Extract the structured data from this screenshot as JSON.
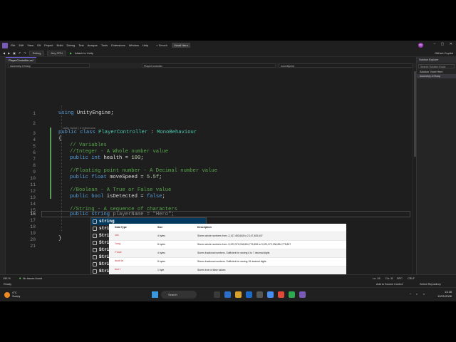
{
  "menubar": {
    "items": [
      "File",
      "Edit",
      "View",
      "Git",
      "Project",
      "Build",
      "Debug",
      "Test",
      "Analyze",
      "Tools",
      "Extensions",
      "Window",
      "Help"
    ],
    "search": "Search",
    "solution": "Voxel Hero",
    "avatar": "KR",
    "window_controls": "– ▢ ✕"
  },
  "toolbar": {
    "config": "Debug",
    "platform": "Any CPU",
    "attach": "Attach to Unity",
    "copilot": "GitHub Copilot"
  },
  "tab": {
    "title": "PlayerController.cs*"
  },
  "navbar": {
    "project": "Assembly-CSharp",
    "class": "PlayerController",
    "member": "moveSpeed"
  },
  "editor": {
    "lines": [
      {
        "n": "1",
        "text": "using UnityEngine;"
      },
      {
        "n": "2",
        "text": ""
      },
      {
        "n": "3",
        "text": "public class PlayerController : MonoBehaviour"
      },
      {
        "n": "4",
        "text": "{"
      },
      {
        "n": "5",
        "text": "// Variables"
      },
      {
        "n": "6",
        "text": "//Integer - A Whole number value"
      },
      {
        "n": "7",
        "text": "public int health = 100;"
      },
      {
        "n": "8",
        "text": ""
      },
      {
        "n": "9",
        "text": "//Floating point number - A Decimal number value"
      },
      {
        "n": "10",
        "text": "public float moveSpeed = 5.5f;"
      },
      {
        "n": "11",
        "text": ""
      },
      {
        "n": "12",
        "text": "//Boolean - A True or False value"
      },
      {
        "n": "13",
        "text": "public bool isDetected = false;"
      },
      {
        "n": "14",
        "text": ""
      },
      {
        "n": "15",
        "text": "//String - A sequence of characters"
      },
      {
        "n": "16",
        "text": "public string playerName = \"Hero\";"
      },
      {
        "n": "17",
        "text": ""
      },
      {
        "n": "18",
        "text": ""
      },
      {
        "n": "19",
        "text": ""
      },
      {
        "n": "20",
        "text": "}"
      },
      {
        "n": "21",
        "text": ""
      }
    ],
    "codelens": "Unity Script | 0 references",
    "code": {
      "l1_using": "using",
      "l1_ns": "UnityEngine;",
      "l3_public": "public",
      "l3_class": "class",
      "l3_name": "PlayerController",
      "l3_colon": " : ",
      "l3_base": "MonoBehaviour",
      "l5": "// Variables",
      "l6": "//Integer - A Whole number value",
      "l7_public": "public",
      "l7_int": "int",
      "l7_rest": " health = ",
      "l7_num": "100",
      "l7_end": ";",
      "l9": "//Floating point number - A Decimal number value",
      "l10_public": "public",
      "l10_float": "float",
      "l10_rest": " moveSpeed = ",
      "l10_num": "5.5f",
      "l10_end": ";",
      "l12": "//Boolean - A True or False value",
      "l13_public": "public",
      "l13_bool": "bool",
      "l13_rest": " isDetected = ",
      "l13_false": "false",
      "l13_end": ";",
      "l15": "//String - A sequence of characters",
      "l16_public": "public",
      "l16_string": "string",
      "l16_rest": " playerName = ",
      "l16_str": "\"Hero\"",
      "l16_end": ";",
      "brace_open": "{",
      "brace_close": "}"
    }
  },
  "completion": {
    "items": [
      {
        "bold": "string",
        "rest": ""
      },
      {
        "bold": "string",
        "rest": "..."
      },
      {
        "bold": "String",
        "rest": "..."
      },
      {
        "bold": "String",
        "rest": "..."
      },
      {
        "bold": "String",
        "rest": "..."
      },
      {
        "bold": "String",
        "rest": "..."
      },
      {
        "bold": "String",
        "rest": "..."
      },
      {
        "bold": "String",
        "rest": "..."
      },
      {
        "bold": "String",
        "rest": "..."
      }
    ]
  },
  "tooltip": {
    "headers": [
      "Data Type",
      "Size",
      "Description"
    ],
    "rows": [
      {
        "type": "int",
        "size": "4 bytes",
        "desc": "Stores whole numbers from -2,147,483,648 to 2,147,483,647"
      },
      {
        "type": "long",
        "size": "8 bytes",
        "desc": "Stores whole numbers from -9,223,372,036,854,775,808 to 9,223,372,036,854,775,807"
      },
      {
        "type": "float",
        "size": "4 bytes",
        "desc": "Stores fractional numbers. Sufficient for storing 6 to 7 decimal digits"
      },
      {
        "type": "double",
        "size": "8 bytes",
        "desc": "Stores fractional numbers. Sufficient for storing 15 decimal digits"
      },
      {
        "type": "bool",
        "size": "1 byte",
        "desc": "Stores true or false values"
      },
      {
        "type": "char",
        "size": "2 bytes",
        "desc": "Stores a single character/letter, surrounded by single quotes"
      },
      {
        "type": "string",
        "size": "2 bytes per character",
        "desc": "Stores a sequence of characters, surrounded by double quotes"
      }
    ]
  },
  "solution_explorer": {
    "title": "Solution Explorer",
    "search": "Search Solution Explo",
    "nodes": [
      "Solution 'Voxel Hero'",
      "Assembly-CSharp"
    ]
  },
  "status": {
    "zoom": "150 %",
    "issues": "No issues found",
    "ln": "Ln: 16",
    "ch": "Ch: 11",
    "spc": "SPC",
    "crlf": "CRLF",
    "ready": "Ready",
    "source": "Add to Source Control",
    "repo": "Select Repository"
  },
  "taskbar": {
    "temp": "4°C",
    "weather": "Sunny",
    "search": "Search",
    "time": "13:18",
    "date": "12/01/2026"
  },
  "colors": {
    "keyword": "#569cd6",
    "type": "#4ec9b0",
    "comment": "#57a64a",
    "string": "#d69d85",
    "accent": "#7160e8"
  }
}
